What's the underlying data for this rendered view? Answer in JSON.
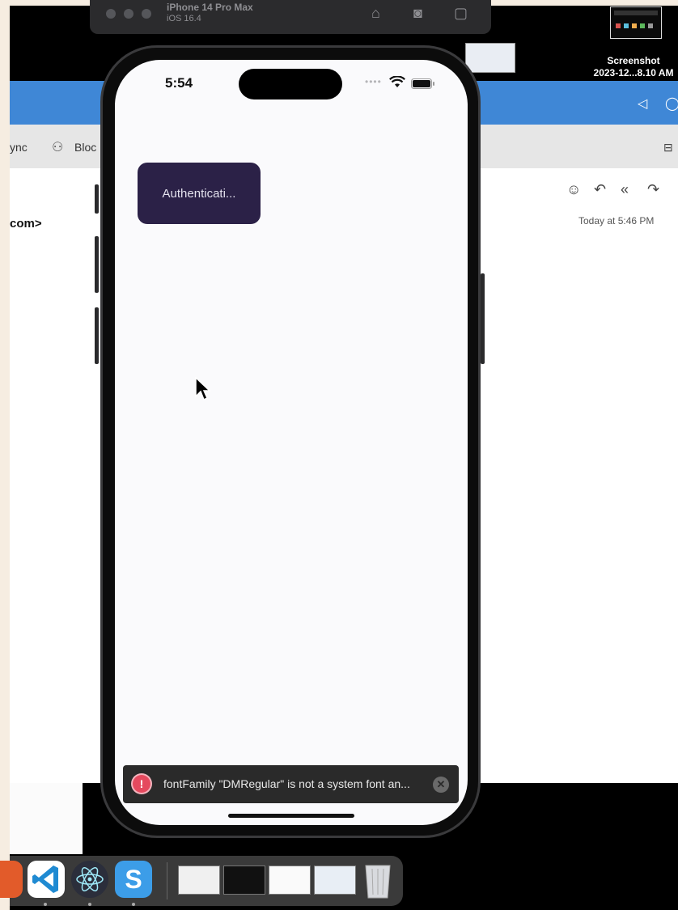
{
  "simulator": {
    "device_name": "iPhone 14 Pro Max",
    "os_version": "iOS 16.4"
  },
  "desktop": {
    "screenshot_label": "Screenshot\n2023-12...8.10 AM"
  },
  "mail": {
    "toolbar_items": [
      "ync",
      "Bloc"
    ],
    "sender_partial": "com>",
    "date": "Today at 5:46 PM"
  },
  "phone": {
    "status_time": "5:54",
    "auth_button_label": "Authenticati...",
    "error_message": "fontFamily \"DMRegular\" is not a system font an..."
  },
  "dock": {
    "apps": [
      "vscode-icon",
      "electron-icon",
      "sublime-icon",
      "trash-icon"
    ]
  },
  "colors": {
    "mail_titlebar": "#3f87d6",
    "auth_button": "#2b2147",
    "error_icon": "#e5495e",
    "toast_bg": "#2a2a2a"
  }
}
